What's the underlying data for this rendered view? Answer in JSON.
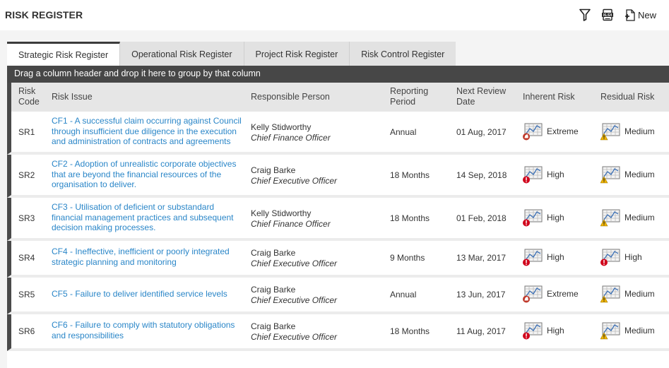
{
  "header": {
    "title": "RISK REGISTER",
    "new_label": "New",
    "filter_icon": "filter-icon",
    "excel_icon": "excel-export-icon",
    "new_icon": "new-document-icon"
  },
  "tabs": [
    {
      "label": "Strategic Risk Register",
      "active": true
    },
    {
      "label": "Operational Risk Register",
      "active": false
    },
    {
      "label": "Project Risk Register",
      "active": false
    },
    {
      "label": "Risk Control Register",
      "active": false
    }
  ],
  "grid": {
    "group_hint": "Drag a column header and drop it here to group by that column",
    "columns": {
      "code_l1": "Risk",
      "code_l2": "Code",
      "issue": "Risk Issue",
      "person": "Responsible Person",
      "period_l1": "Reporting",
      "period_l2": "Period",
      "review_l1": "Next Review",
      "review_l2": "Date",
      "inherent": "Inherent Risk",
      "residual": "Residual Risk"
    },
    "rows": [
      {
        "code": "SR1",
        "issue": "CF1 - A successful claim occurring against Council through insufficient due diligence in the execution and administration of contracts and agreements",
        "person": "Kelly Stidworthy",
        "role": "Chief Finance Officer",
        "period": "Annual",
        "review": "01 Aug, 2017",
        "inherent": "Extreme",
        "residual": "Medium"
      },
      {
        "code": "SR2",
        "issue": "CF2 - Adoption of unrealistic corporate objectives that are beyond the financial resources of the organisation to deliver.",
        "person": "Craig Barke",
        "role": "Chief Executive Officer",
        "period": "18 Months",
        "review": "14 Sep, 2018",
        "inherent": "High",
        "residual": "Medium"
      },
      {
        "code": "SR3",
        "issue": "CF3 - Utilisation of deficient or substandard financial management practices and subsequent decision making processes.",
        "person": "Kelly Stidworthy",
        "role": "Chief Finance Officer",
        "period": "18 Months",
        "review": "01 Feb, 2018",
        "inherent": "High",
        "residual": "Medium"
      },
      {
        "code": "SR4",
        "issue": "CF4 - Ineffective, inefficient or poorly integrated strategic planning and monitoring",
        "person": "Craig Barke",
        "role": "Chief Executive Officer",
        "period": "9 Months",
        "review": "13 Mar, 2017",
        "inherent": "High",
        "residual": "High"
      },
      {
        "code": "SR5",
        "issue": "CF5 - Failure to deliver identified service levels",
        "person": "Craig Barke",
        "role": "Chief Executive Officer",
        "period": "Annual",
        "review": "13 Jun, 2017",
        "inherent": "Extreme",
        "residual": "Medium"
      },
      {
        "code": "SR6",
        "issue": "CF6 - Failure to comply with statutory obligations and responsibilities",
        "person": "Craig Barke",
        "role": "Chief Executive Officer",
        "period": "18 Months",
        "review": "11 Aug, 2017",
        "inherent": "High",
        "residual": "Medium"
      }
    ]
  },
  "colors": {
    "link": "#2a86c8",
    "extreme": "#c0392b",
    "high": "#d0021b",
    "medium": "#f0b400",
    "header_dark": "#474747"
  }
}
